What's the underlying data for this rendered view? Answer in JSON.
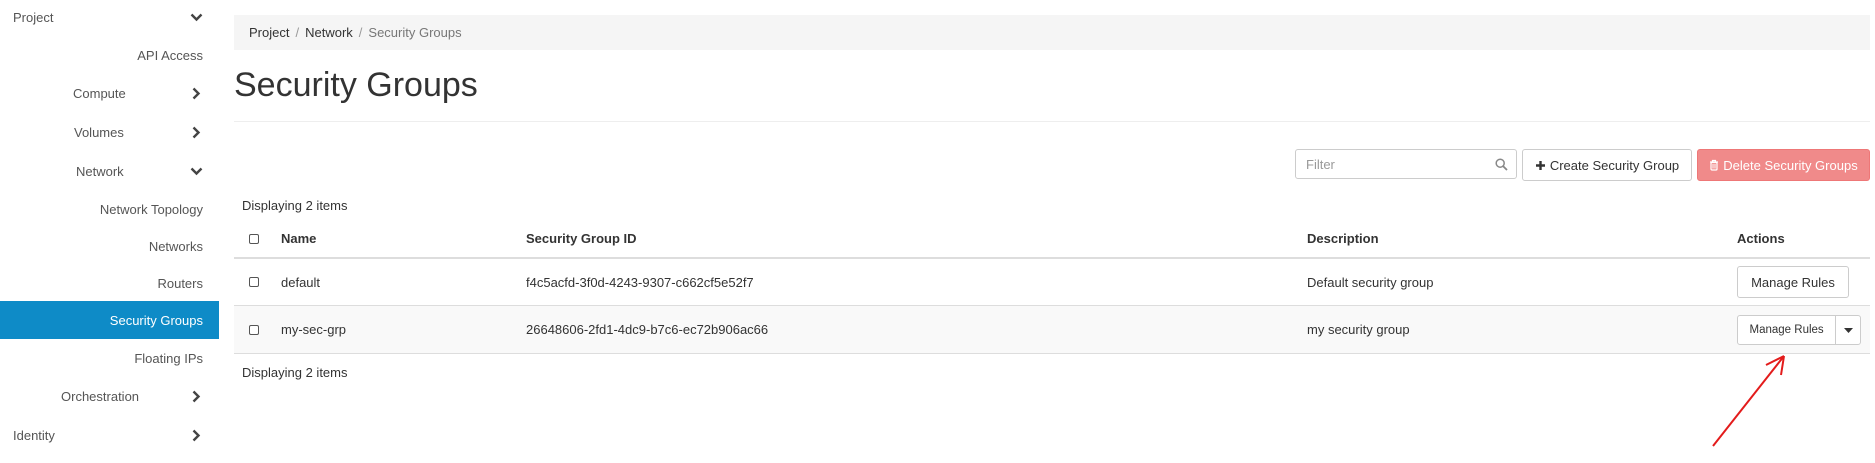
{
  "sidebar": {
    "project": "Project",
    "api_access": "API Access",
    "compute": "Compute",
    "volumes": "Volumes",
    "network": "Network",
    "network_topology": "Network Topology",
    "networks": "Networks",
    "routers": "Routers",
    "security_groups": "Security Groups",
    "floating_ips": "Floating IPs",
    "orchestration": "Orchestration",
    "identity": "Identity"
  },
  "breadcrumb": {
    "project": "Project",
    "network": "Network",
    "current": "Security Groups",
    "separator": "/"
  },
  "page": {
    "title": "Security Groups"
  },
  "toolbar": {
    "filter_placeholder": "Filter",
    "create_label": "Create Security Group",
    "delete_label": "Delete Security Groups"
  },
  "table": {
    "displaying_top": "Displaying 2 items",
    "displaying_bottom": "Displaying 2 items",
    "headers": {
      "name": "Name",
      "id": "Security Group ID",
      "description": "Description",
      "actions": "Actions"
    },
    "rows": [
      {
        "name": "default",
        "id": "f4c5acfd-3f0d-4243-9307-c662cf5e52f7",
        "description": "Default security group",
        "action": "Manage Rules"
      },
      {
        "name": "my-sec-grp",
        "id": "26648606-2fd1-4dc9-b7c6-ec72b906ac66",
        "description": "my security group",
        "action": "Manage Rules"
      }
    ]
  },
  "colors": {
    "active_sidebar": "#0e8bc7",
    "delete_button": "#f08a8a",
    "annotation_arrow": "#e31b1b"
  }
}
